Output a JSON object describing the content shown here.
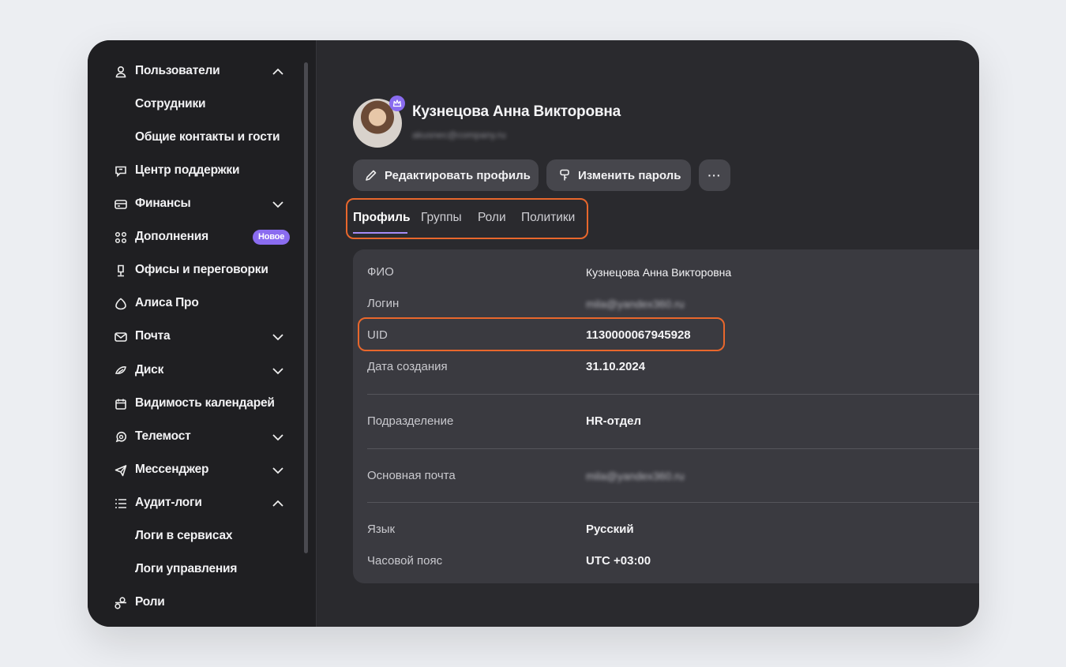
{
  "sidebar": {
    "items": [
      {
        "label": "Пользователи",
        "icon": "user-icon",
        "chevron": "up"
      },
      {
        "label": "Сотрудники",
        "sub": true
      },
      {
        "label": "Общие контакты и гости",
        "sub": true
      },
      {
        "label": "Центр поддержки",
        "icon": "support-chat-icon"
      },
      {
        "label": "Финансы",
        "icon": "wallet-icon",
        "chevron": "down"
      },
      {
        "label": "Дополнения",
        "icon": "grid-icon",
        "badge": "Новое"
      },
      {
        "label": "Офисы и переговорки",
        "icon": "office-icon"
      },
      {
        "label": "Алиса Про",
        "icon": "alice-icon"
      },
      {
        "label": "Почта",
        "icon": "mail-icon",
        "chevron": "down"
      },
      {
        "label": "Диск",
        "icon": "disk-icon",
        "chevron": "down"
      },
      {
        "label": "Видимость календарей",
        "icon": "calendar-icon"
      },
      {
        "label": "Телемост",
        "icon": "telemost-icon",
        "chevron": "down"
      },
      {
        "label": "Мессенджер",
        "icon": "messenger-icon",
        "chevron": "down"
      },
      {
        "label": "Аудит-логи",
        "icon": "list-icon",
        "chevron": "up"
      },
      {
        "label": "Логи в сервисах",
        "sub": true
      },
      {
        "label": "Логи управления",
        "sub": true
      },
      {
        "label": "Роли",
        "icon": "roles-icon"
      }
    ]
  },
  "profile": {
    "name": "Кузнецова Анна Викторовна",
    "email": "akusnec@company.ru"
  },
  "actions": {
    "edit_label": "Редактировать профиль",
    "password_label": "Изменить пароль",
    "more_label": "···"
  },
  "tabs": [
    {
      "label": "Профиль",
      "active": true
    },
    {
      "label": "Группы"
    },
    {
      "label": "Роли"
    },
    {
      "label": "Политики"
    }
  ],
  "details": {
    "fio_label": "ФИО",
    "fio_value": "Кузнецова Анна Викторовна",
    "login_label": "Логин",
    "login_value": "mila@yandex360.ru",
    "uid_label": "UID",
    "uid_value": "1130000067945928",
    "created_label": "Дата создания",
    "created_value": "31.10.2024",
    "department_label": "Подразделение",
    "department_value": "HR-отдел",
    "email_label": "Основная почта",
    "email_value": "mila@yandex360.ru",
    "language_label": "Язык",
    "language_value": "Русский",
    "timezone_label": "Часовой пояс",
    "timezone_value": "UTC +03:00"
  },
  "colors": {
    "highlight": "#e8672c",
    "accent": "#8a6cf0"
  }
}
